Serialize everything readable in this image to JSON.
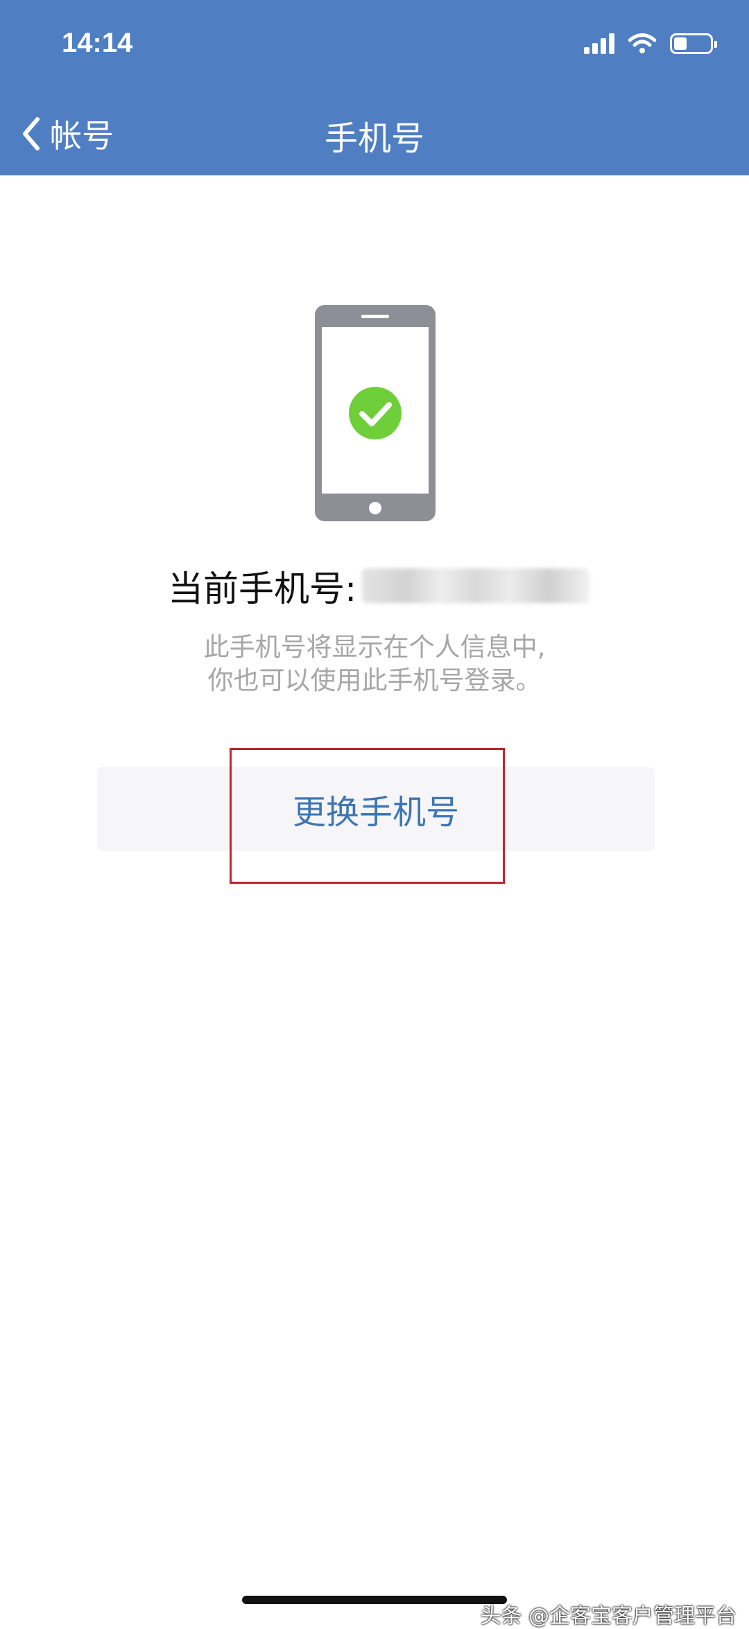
{
  "status_bar": {
    "time": "14:14"
  },
  "nav": {
    "back_label": "帐号",
    "title": "手机号"
  },
  "main": {
    "current_phone_label": "当前手机号:",
    "description_line1": "此手机号将显示在个人信息中,",
    "description_line2": "你也可以使用此手机号登录。",
    "change_button_label": "更换手机号"
  },
  "watermark": "头条 @企客宝客户管理平台",
  "colors": {
    "header": "#4f7ec3",
    "button_text": "#3e75b4",
    "check_green": "#6fcf3b",
    "highlight_red": "#c0262c"
  },
  "icons": {
    "back": "chevron-left-icon",
    "signal": "cellular-signal-icon",
    "wifi": "wifi-icon",
    "battery": "battery-icon",
    "phone": "smartphone-icon",
    "check": "check-circle-icon"
  }
}
